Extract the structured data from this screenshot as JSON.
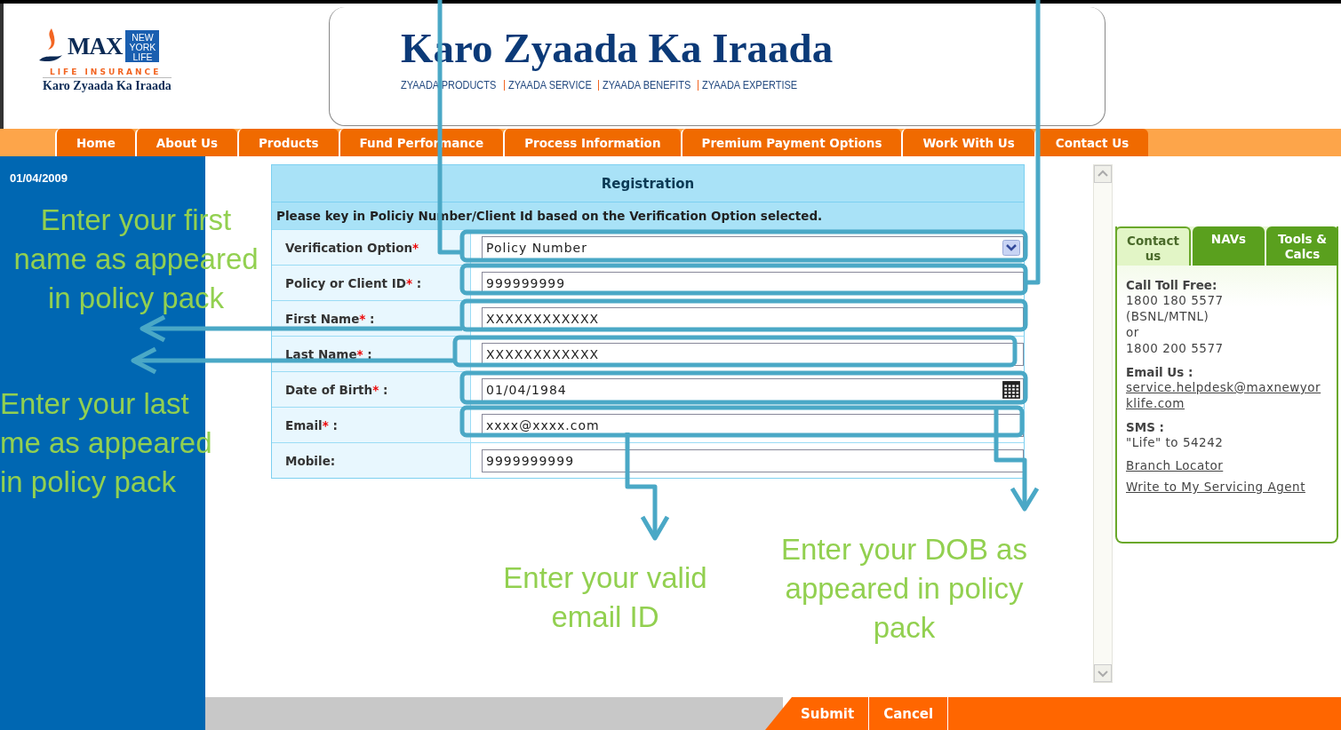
{
  "header": {
    "logo": {
      "brand": "MAX",
      "partner": [
        "NEW",
        "YORK",
        "LIFE"
      ],
      "subtitle": "LIFE INSURANCE",
      "slogan": "Karo Zyaada Ka Iraada"
    },
    "banner": {
      "title": "Karo Zyaada Ka Iraada",
      "taglines": [
        "ZYAADA PRODUCTS",
        "ZYAADA SERVICE",
        "ZYAADA BENEFITS",
        "ZYAADA EXPERTISE"
      ]
    }
  },
  "nav": [
    {
      "label": "Home",
      "selected": false
    },
    {
      "label": "About Us",
      "selected": false
    },
    {
      "label": "Products",
      "selected": false
    },
    {
      "label": "Fund Performance",
      "selected": false
    },
    {
      "label": "Process Information",
      "selected": false
    },
    {
      "label": "Premium Payment Options",
      "selected": false
    },
    {
      "label": "Work With Us",
      "selected": false
    },
    {
      "label": "Contact Us",
      "selected": false
    }
  ],
  "sidebar": {
    "date": "01/04/2009"
  },
  "form": {
    "title": "Registration",
    "instruction": "Please key in Policiy Number/Client Id based on the Verification Option selected.",
    "fields": [
      {
        "kind": "select",
        "label": "Verification Option",
        "mark": "*",
        "value": "Policy Number"
      },
      {
        "kind": "text",
        "label": "Policy or Client ID",
        "mark": "*",
        "after": " :",
        "value": "999999999"
      },
      {
        "kind": "text",
        "label": "First Name",
        "mark": "*",
        "after": " :",
        "value": "XXXXXXXXXXXX"
      },
      {
        "kind": "text",
        "label": "Last Name",
        "mark": "*",
        "after": " :",
        "value": "XXXXXXXXXXXX"
      },
      {
        "kind": "date",
        "label": "Date of Birth",
        "mark": "*",
        "after": " :",
        "value": "01/04/1984"
      },
      {
        "kind": "text",
        "label": "Email",
        "mark": "*",
        "after": " :",
        "value": "xxxx@xxxx.com"
      },
      {
        "kind": "text",
        "label": "Mobile:",
        "value": "9999999999"
      }
    ]
  },
  "contact_panel": {
    "tabs": [
      {
        "label": "Contact us",
        "selected": true
      },
      {
        "label": "NAVs",
        "selected": false
      },
      {
        "label": "Tools & Calcs",
        "selected": false
      }
    ],
    "sections": [
      {
        "heading": "Call Toll Free:",
        "lines": [
          "1800 180 5577",
          "(BSNL/MTNL)",
          "or",
          "1800 200 5577"
        ]
      },
      {
        "heading": "Email Us :",
        "link": "service.helpdesk@maxnewyorklife.com"
      },
      {
        "heading": "SMS :",
        "lines": [
          "\"Life\" to 54242"
        ]
      }
    ],
    "links": [
      "Branch Locator",
      "Write to My Servicing Agent"
    ]
  },
  "buttons": [
    "Submit",
    "Cancel"
  ],
  "annotations": [
    {
      "lines": [
        "Enter your first",
        "name as appeared",
        "in policy pack"
      ]
    },
    {
      "lines": [
        "Enter your last",
        "me as appeared",
        "in policy pack"
      ]
    },
    {
      "lines": [
        "Enter your valid",
        "email ID"
      ]
    },
    {
      "lines": [
        "Enter your DOB as",
        "appeared in policy",
        "pack"
      ]
    }
  ]
}
